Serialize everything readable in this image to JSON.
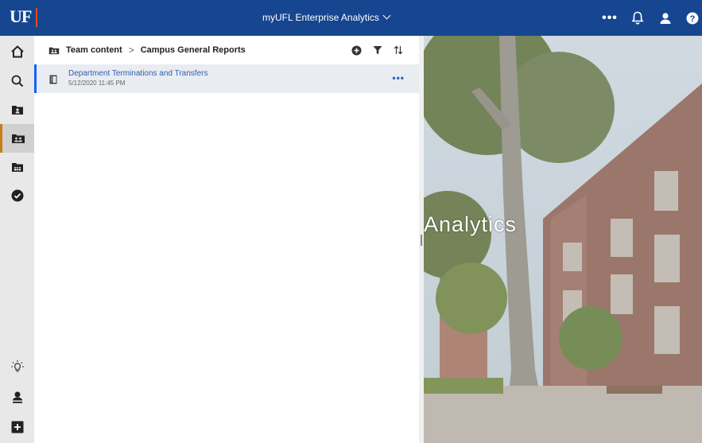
{
  "topbar": {
    "logo": "UF",
    "title": "myUFL Enterprise Analytics",
    "more_label": "•••",
    "icons": [
      "chevron-down-icon",
      "more-icon",
      "bell-icon",
      "user-icon",
      "help-icon"
    ]
  },
  "leftnav": {
    "items": [
      {
        "name": "home",
        "icon": "home-icon"
      },
      {
        "name": "search",
        "icon": "search-icon"
      },
      {
        "name": "my-content",
        "icon": "folder-user-icon"
      },
      {
        "name": "team-content",
        "icon": "team-folder-icon",
        "active": true
      },
      {
        "name": "recent",
        "icon": "calendar-folder-icon"
      },
      {
        "name": "subscriptions",
        "icon": "check-circle-icon"
      },
      {
        "name": "learn",
        "icon": "lightbulb-icon"
      },
      {
        "name": "personal-menu",
        "icon": "user-avatar-icon"
      },
      {
        "name": "new",
        "icon": "plus-icon"
      }
    ]
  },
  "breadcrumb": {
    "root": "Team content",
    "separator": ">",
    "current": "Campus General Reports"
  },
  "list": {
    "items": [
      {
        "title": "Department Terminations and Transfers",
        "date": "5/12/2020 11:45 PM",
        "more": "•••"
      }
    ]
  },
  "hero": {
    "text": "Analytics"
  },
  "colors": {
    "topbar": "#16468f",
    "accent": "#fa4616",
    "link": "#2d5fb4",
    "active_nav": "#c77d1a"
  }
}
